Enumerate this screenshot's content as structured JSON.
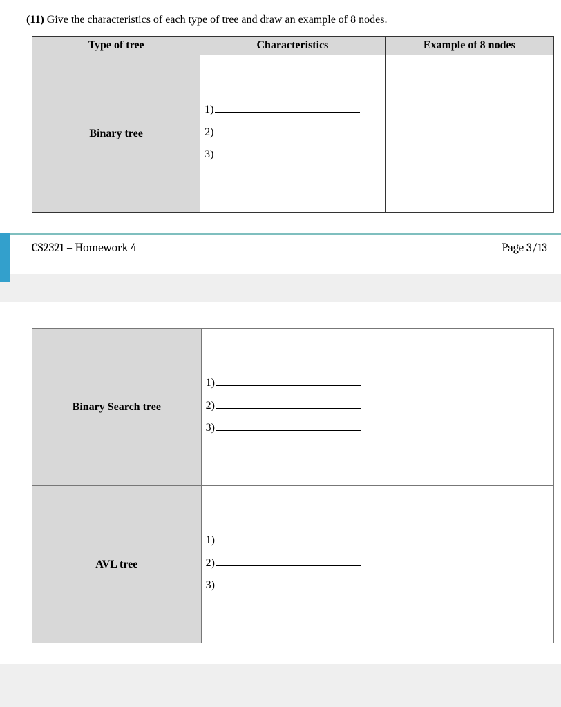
{
  "question": {
    "number": "(11)",
    "text": "Give the characteristics of each type of tree and draw an example of 8 nodes."
  },
  "headers": {
    "type": "Type of tree",
    "characteristics": "Characteristics",
    "example": "Example of 8 nodes"
  },
  "rows": {
    "binary": {
      "name": "Binary tree",
      "char1": "1)",
      "char2": "2)",
      "char3": "3)"
    },
    "bst": {
      "name": "Binary Search tree",
      "char1": "1)",
      "char2": "2)",
      "char3": "3)"
    },
    "avl": {
      "name": "AVL tree",
      "char1": "1)",
      "char2": "2)",
      "char3": "3)"
    }
  },
  "footer": {
    "course": "CS2321 – Homework 4",
    "page": "Page 3/13"
  }
}
